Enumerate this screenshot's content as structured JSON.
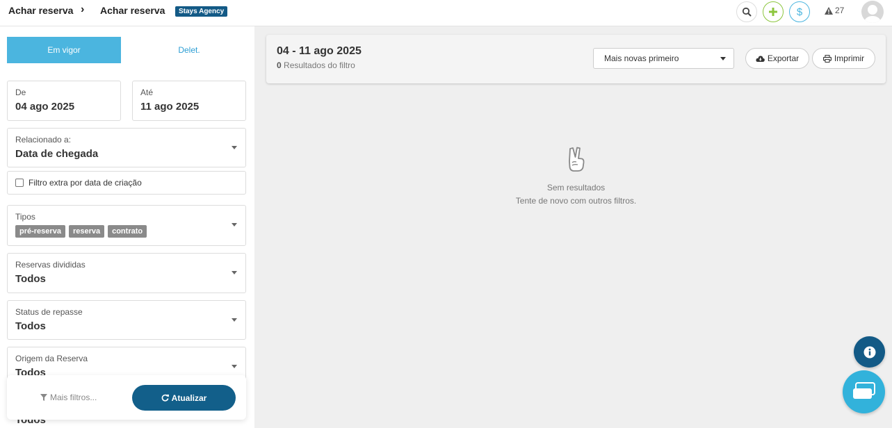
{
  "header": {
    "breadcrumb": [
      "Achar reserva",
      "Achar reserva"
    ],
    "separator": "›",
    "agency_badge": "Stays Agency",
    "alert_count": "27",
    "icons": [
      "search-icon",
      "plus-icon",
      "dollar-icon",
      "alert-icon",
      "avatar-icon"
    ],
    "colors": {
      "plus": "#8cc63e",
      "dollar": "#4bb5df",
      "badge": "#135a86"
    }
  },
  "sidebar": {
    "tabs": [
      {
        "label": "Em vigor",
        "active": true
      },
      {
        "label": "Delet.",
        "active": false
      }
    ],
    "date_from": {
      "label": "De",
      "value": "04 ago 2025"
    },
    "date_to": {
      "label": "Até",
      "value": "11 ago 2025"
    },
    "related": {
      "label": "Relacionado a:",
      "value": "Data de chegada"
    },
    "extra_filter": {
      "label": "Filtro extra por data de criação",
      "checked": false
    },
    "types": {
      "label": "Tipos",
      "tags": [
        "pré-reserva",
        "reserva",
        "contrato"
      ]
    },
    "split_reservations": {
      "label": "Reservas divididas",
      "value": "Todos"
    },
    "transfer_status": {
      "label": "Status de repasse",
      "value": "Todos"
    },
    "origin": {
      "label": "Origem da Reserva",
      "value": "Todos"
    },
    "trailing_value": "Todos",
    "more_filters_label": "Mais filtros...",
    "refresh_label": "Atualizar"
  },
  "main": {
    "date_range": "04 - 11 ago 2025",
    "results_count": "0",
    "results_label": "Resultados do filtro",
    "sort": {
      "selected": "Mais novas primeiro"
    },
    "export_label": "Exportar",
    "print_label": "Imprimir",
    "empty_title": "Sem resultados",
    "empty_subtitle": "Tente de novo com outros filtros."
  },
  "colors": {
    "accent": "#4bb5df",
    "primary": "#125f8a",
    "tag": "#8a8a8a"
  }
}
